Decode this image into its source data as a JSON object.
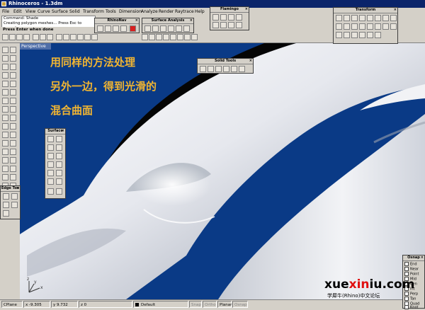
{
  "window": {
    "title": "Rhinoceros - 1.3dm"
  },
  "menu": [
    "File",
    "Edit",
    "View",
    "Curve",
    "Surface",
    "Solid",
    "Transform",
    "Tools",
    "Dimension",
    "Analyze",
    "Render",
    "Raytrace",
    "Help"
  ],
  "command": {
    "lines": [
      "Command: Shade",
      "Creating polygon meshes... Press Esc to cancel"
    ],
    "prompt": "Press Enter when done"
  },
  "viewport": {
    "tab_label": "Perspective",
    "annotation_lines": [
      "用同样的方法处理",
      "另外一边，得到光滑的",
      "混合曲面"
    ],
    "axis_labels": {
      "x": "x",
      "y": "y",
      "z": "z"
    }
  },
  "palettes": {
    "flamingo": "Flamingo",
    "transform": "Transform",
    "rhinonav": "RhinoNav",
    "surface_analysis": "Surface Analysis",
    "solid_tools": "Solid Tools",
    "surface": "Surface",
    "edge_tools": "Edge Too"
  },
  "osnap": {
    "title": "Osnap",
    "items": [
      "End",
      "Near",
      "Point",
      "Mid",
      "Cen",
      "Int",
      "Perp",
      "Tan",
      "Quad",
      "Knot"
    ]
  },
  "status": {
    "cplane": "CPlane",
    "x": "x -9.305",
    "y": "y 9.732",
    "z": "z 0",
    "layer": "Default",
    "snap": "Snap",
    "ortho": "Ortho",
    "planar": "Planar",
    "osnap": "Osnap"
  },
  "watermark": {
    "pre": "xue",
    "accent": "xin",
    "post": "iu.com",
    "forum": "学犀牛(Rhino)中文论坛"
  },
  "colors": {
    "viewport_bg": "#0a3a86",
    "annotation": "#f0b432",
    "titlebar": "#0a246a"
  }
}
